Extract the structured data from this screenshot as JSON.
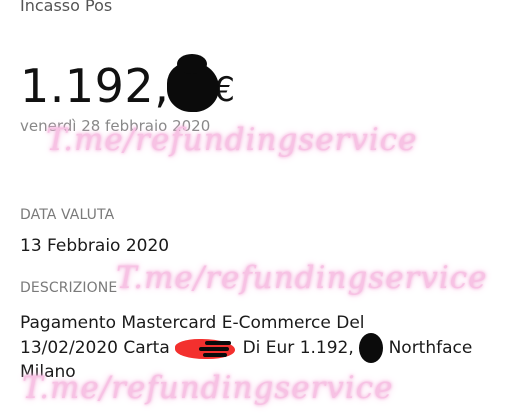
{
  "header": {
    "label": "Incasso Pos"
  },
  "amount": {
    "integer_part": "1.192,",
    "currency": "€"
  },
  "date": {
    "text": "venerdì 28 febbraio 2020"
  },
  "watermark": {
    "text": "T.me/refundingservice"
  },
  "value_date": {
    "label": "DATA VALUTA",
    "value": "13 Febbraio 2020"
  },
  "description": {
    "label": "DESCRIZIONE",
    "line1": "Pagamento Mastercard E-Commerce Del",
    "line2_prefix": "13/02/2020 Carta",
    "line2_middle": "Di Eur 1.192,",
    "line2_suffix": "Northface",
    "line3": "Milano"
  },
  "colors": {
    "redaction_black": "#0b0b0b",
    "redaction_red": "#f3302e",
    "watermark_pink": "#f7c2e4"
  }
}
